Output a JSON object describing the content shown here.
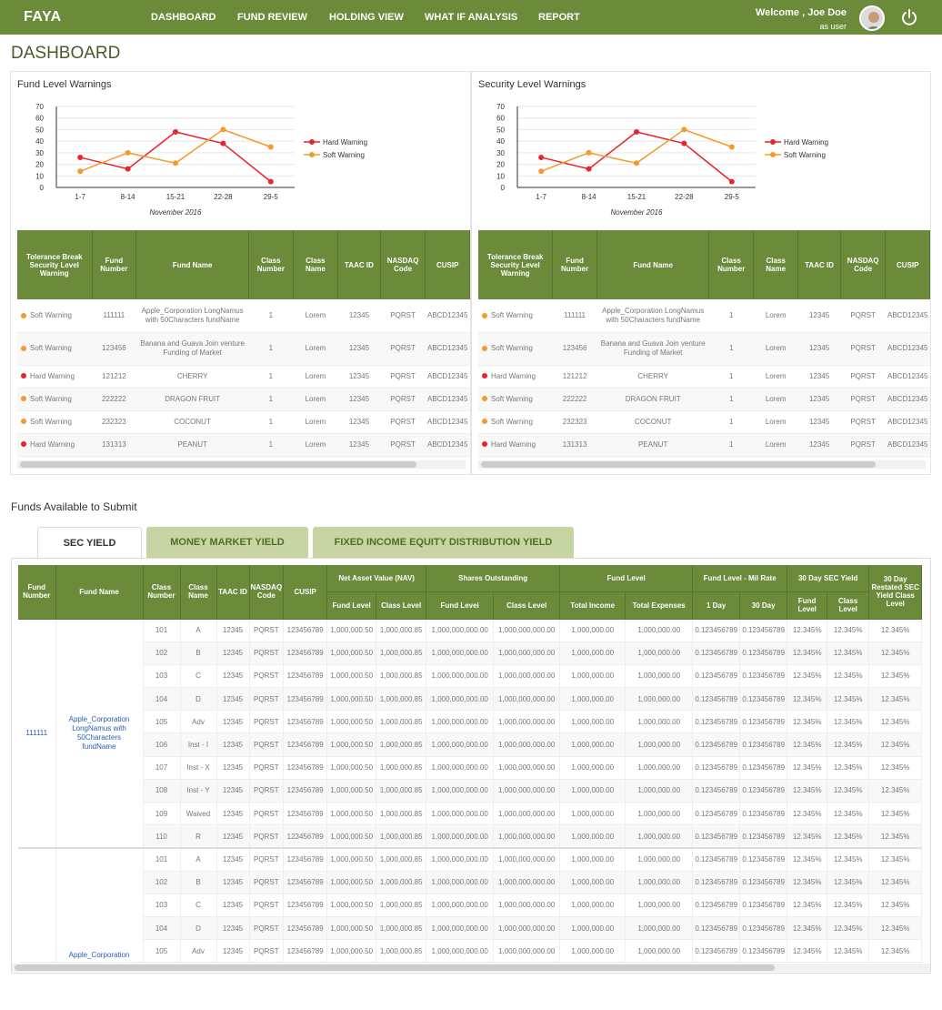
{
  "app": {
    "logo": "FAYA",
    "welcome": "Welcome , Joe Doe",
    "role": "as user"
  },
  "nav": [
    "DASHBOARD",
    "FUND REVIEW",
    "HOLDING VIEW",
    "WHAT IF ANALYSIS",
    "REPORT"
  ],
  "page_title": "DASHBOARD",
  "panels": [
    {
      "title": "Fund Level Warnings"
    },
    {
      "title": "Security Level Warnings"
    }
  ],
  "colors": {
    "accent": "#6b8a3a",
    "hard": "#e8242d",
    "soft": "#f39a2c",
    "link": "#2a5db0"
  },
  "chart_data": [
    {
      "type": "line",
      "title": "Fund Level Warnings",
      "categories": [
        "1-7",
        "8-14",
        "15-21",
        "22-28",
        "29-5"
      ],
      "xlabel": "November 2016",
      "ylim": [
        0,
        70
      ],
      "yticks": [
        0,
        10,
        20,
        30,
        40,
        50,
        60,
        70
      ],
      "grid": true,
      "legend": "right",
      "series": [
        {
          "name": "Hard Warning",
          "color": "#e8242d",
          "values": [
            26,
            16,
            48,
            38,
            5
          ]
        },
        {
          "name": "Soft Warning",
          "color": "#f39a2c",
          "values": [
            14,
            30,
            21,
            50,
            35
          ]
        }
      ]
    },
    {
      "type": "line",
      "title": "Security Level Warnings",
      "categories": [
        "1-7",
        "8-14",
        "15-21",
        "22-28",
        "29-5"
      ],
      "xlabel": "November 2016",
      "ylim": [
        0,
        70
      ],
      "yticks": [
        0,
        10,
        20,
        30,
        40,
        50,
        60,
        70
      ],
      "grid": true,
      "legend": "right",
      "series": [
        {
          "name": "Hard Warning",
          "color": "#e8242d",
          "values": [
            26,
            16,
            48,
            38,
            5
          ]
        },
        {
          "name": "Soft Warning",
          "color": "#f39a2c",
          "values": [
            14,
            30,
            21,
            50,
            35
          ]
        }
      ]
    }
  ],
  "warning_table": {
    "headers": [
      "Tolerance Break Security Level Warning",
      "Fund Number",
      "Fund Name",
      "Class Number",
      "Class Name",
      "TAAC ID",
      "NASDAQ Code",
      "CUSIP"
    ],
    "rows": [
      {
        "warning": "Soft Warning",
        "level": "soft",
        "fund_number": "111111",
        "fund_name": "Apple_Corporation LongNamus with 50Characters fundName",
        "class_number": "1",
        "class_name": "Lorem",
        "taac": "12345",
        "nasdaq": "PQRST",
        "cusip": "ABCD12345",
        "tall": true
      },
      {
        "warning": "Soft Warning",
        "level": "soft",
        "fund_number": "123456",
        "fund_name": "Banana and Guava Join venture Funding of Market",
        "class_number": "1",
        "class_name": "Lorem",
        "taac": "12345",
        "nasdaq": "PQRST",
        "cusip": "ABCD12345",
        "tall": true
      },
      {
        "warning": "Hard Warning",
        "level": "hard",
        "fund_number": "121212",
        "fund_name": "CHERRY",
        "class_number": "1",
        "class_name": "Lorem",
        "taac": "12345",
        "nasdaq": "PQRST",
        "cusip": "ABCD12345"
      },
      {
        "warning": "Soft Warning",
        "level": "soft",
        "fund_number": "222222",
        "fund_name": "DRAGON FRUIT",
        "class_number": "1",
        "class_name": "Lorem",
        "taac": "12345",
        "nasdaq": "PQRST",
        "cusip": "ABCD12345"
      },
      {
        "warning": "Soft Warning",
        "level": "soft",
        "fund_number": "232323",
        "fund_name": "COCONUT",
        "class_number": "1",
        "class_name": "Lorem",
        "taac": "12345",
        "nasdaq": "PQRST",
        "cusip": "ABCD12345"
      },
      {
        "warning": "Hard Warning",
        "level": "hard",
        "fund_number": "131313",
        "fund_name": "PEANUT",
        "class_number": "1",
        "class_name": "Lorem",
        "taac": "12345",
        "nasdaq": "PQRST",
        "cusip": "ABCD12345"
      }
    ]
  },
  "funds_section": {
    "title": "Funds Available to Submit",
    "tabs": [
      "SEC YIELD",
      "MONEY MARKET YIELD",
      "FIXED INCOME EQUITY DISTRIBUTION YIELD"
    ],
    "header_groups": {
      "fund_number": "Fund Number",
      "fund_name": "Fund Name",
      "class_number": "Class Number",
      "class_name": "Class Name",
      "taac": "TAAC ID",
      "nasdaq": "NASDAQ Code",
      "cusip": "CUSIP",
      "nav": "Net Asset Value (NAV)",
      "shares": "Shares Outstanding",
      "fund_level": "Fund Level",
      "mil_rate": "Fund Level - Mil Rate",
      "sec30": "30 Day SEC Yield",
      "restated": "30 Day Restated SEC Yield Class Level"
    },
    "sub_headers": {
      "nav_fund": "Fund Level",
      "nav_class": "Class Level",
      "shares_fund": "Fund Level",
      "shares_class": "Class Level",
      "total_income": "Total Income",
      "total_expenses": "Total Expenses",
      "day1": "1 Day",
      "day30": "30 Day",
      "sec_fund": "Fund Level",
      "sec_class": "Class Level"
    },
    "groups": [
      {
        "fund_number": "111111",
        "fund_name": "Apple_Corporation LongNamus with 50Characters fundName",
        "classes": [
          {
            "num": "101",
            "name": "A"
          },
          {
            "num": "102",
            "name": "B"
          },
          {
            "num": "103",
            "name": "C"
          },
          {
            "num": "104",
            "name": "D"
          },
          {
            "num": "105",
            "name": "Adv"
          },
          {
            "num": "106",
            "name": "Inst - I"
          },
          {
            "num": "107",
            "name": "Inst - X"
          },
          {
            "num": "108",
            "name": "Inst - Y"
          },
          {
            "num": "109",
            "name": "Waived"
          },
          {
            "num": "110",
            "name": "R"
          }
        ]
      },
      {
        "fund_number": "",
        "fund_name": "Apple_Corporation",
        "classes": [
          {
            "num": "101",
            "name": "A"
          },
          {
            "num": "102",
            "name": "B"
          },
          {
            "num": "103",
            "name": "C"
          },
          {
            "num": "104",
            "name": "D"
          },
          {
            "num": "105",
            "name": "Adv"
          }
        ]
      }
    ],
    "row_values": {
      "taac": "12345",
      "nasdaq": "PQRST",
      "cusip": "123456789",
      "nav_fund": "1,000,000.50",
      "nav_class": "1,000,000.85",
      "shares_fund": "1,000,000,000.00",
      "shares_class": "1,000,000,000.00",
      "total_income": "1,000,000.00",
      "total_expenses": "1,000,000.00",
      "day1": "0.123456789",
      "day30": "0.123456789",
      "sec_fund": "12.345%",
      "sec_class": "12.345%",
      "restated": "12.345%"
    }
  }
}
